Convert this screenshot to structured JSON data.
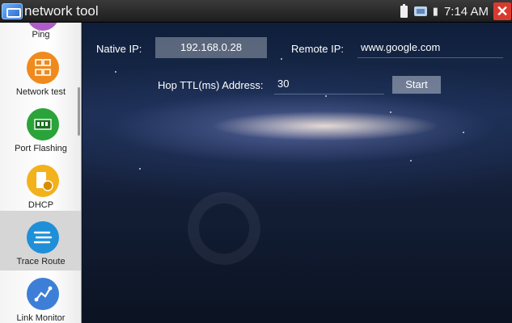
{
  "app": {
    "title": "network tool"
  },
  "status_bar": {
    "time": "7:14 AM"
  },
  "sidebar": {
    "items": [
      {
        "label": "Ping",
        "icon": "ping-icon",
        "color": "#b05cc8"
      },
      {
        "label": "Network test",
        "icon": "network-test-icon",
        "color": "#f08a1c"
      },
      {
        "label": "Port Flashing",
        "icon": "port-flashing-icon",
        "color": "#2aa43a"
      },
      {
        "label": "DHCP",
        "icon": "dhcp-icon",
        "color": "#f2b21c"
      },
      {
        "label": "Trace Route",
        "icon": "trace-route-icon",
        "color": "#1f8fd8",
        "active": true
      },
      {
        "label": "Link Monitor",
        "icon": "link-monitor-icon",
        "color": "#3d7fd6"
      }
    ]
  },
  "form": {
    "native_ip_label": "Native IP:",
    "native_ip_value": "192.168.0.28",
    "remote_ip_label": "Remote IP:",
    "remote_ip_value": "www.google.com",
    "hop_label": "Hop TTL(ms) Address:",
    "hop_value": "30",
    "start_label": "Start"
  }
}
